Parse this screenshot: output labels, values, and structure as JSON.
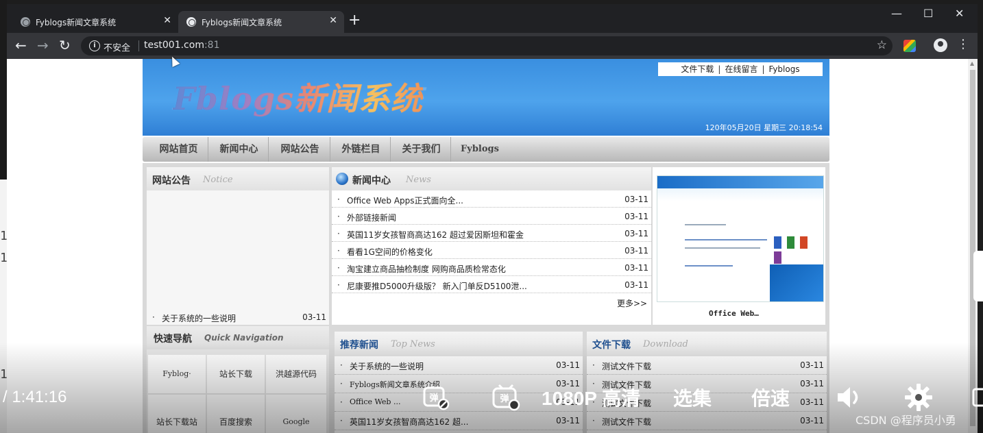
{
  "background": {
    "left_marks": [
      "1",
      "1",
      "1",
      "1"
    ]
  },
  "browser": {
    "tabs": [
      {
        "title": "Fyblogs新闻文章系统",
        "active": false
      },
      {
        "title": "Fyblogs新闻文章系统",
        "active": true
      }
    ],
    "new_tab": "+",
    "window_controls": [
      "—",
      "☐",
      "✕"
    ],
    "back": "←",
    "forward": "→",
    "reload": "↻",
    "security_label": "不安全",
    "url_host": "test001.com",
    "url_port": ":81",
    "star": "☆",
    "menu": "⋮"
  },
  "site": {
    "logo": "Fblogs新闻系统",
    "top_links": [
      "文件下载",
      "在线留言",
      "Fyblogs"
    ],
    "datetime": "120年05月20日 星期三 20:18:54",
    "menu": [
      "网站首页",
      "新闻中心",
      "网站公告",
      "外链栏目",
      "关于我们",
      "Fyblogs"
    ],
    "notice": {
      "title": "网站公告",
      "subtitle": "Notice",
      "items": [
        {
          "title": "关于系统的一些说明",
          "date": "03-11"
        }
      ]
    },
    "news": {
      "title": "新闻中心",
      "subtitle": "News",
      "items": [
        {
          "title": "Office  Web  Apps正式面向全...",
          "date": "03-11"
        },
        {
          "title": "外部链接新闻",
          "date": "03-11"
        },
        {
          "title": "英国11岁女孩智商高达162  超过爱因斯坦和霍金",
          "date": "03-11"
        },
        {
          "title": "看看1G空间的价格变化",
          "date": "03-11"
        },
        {
          "title": "淘宝建立商品抽检制度  网购商品质检常态化",
          "date": "03-11"
        },
        {
          "title": "尼康要推D5000升级版？  新入门单反D5100泄...",
          "date": "03-11"
        }
      ],
      "more": "更多>>",
      "image_caption": "Office  Web…"
    },
    "quick_nav": {
      "title": "快速导航",
      "subtitle": "Quick Navigation",
      "row1": [
        "Fyblog·",
        "站长下载",
        "洪越源代码"
      ],
      "row2": [
        "站长下载站",
        "百度搜索",
        "Google"
      ]
    },
    "top_news": {
      "title": "推荐新闻",
      "subtitle": "Top News",
      "items": [
        {
          "title": "关于系统的一些说明",
          "date": "03-11"
        },
        {
          "title": "Fyblogs新闻文章系统介绍",
          "date": "03-11"
        },
        {
          "title": "Office  Web  ...",
          "date": "03-11"
        },
        {
          "title": "英国11岁女孩智商高达162  超...",
          "date": "03-11"
        }
      ]
    },
    "download": {
      "title": "文件下载",
      "subtitle": "Download",
      "items": [
        {
          "title": "测试文件下载",
          "date": "03-11"
        },
        {
          "title": "测试文件下载",
          "date": "03-11"
        },
        {
          "title": "测试文件下载",
          "date": "03-11"
        },
        {
          "title": "测试文件下载",
          "date": "03-11"
        }
      ]
    }
  },
  "player": {
    "time": "/ 1:41:16",
    "quality": "1080P 高清",
    "episodes": "选集",
    "speed": "倍速"
  },
  "watermark": "CSDN @程序员小勇"
}
